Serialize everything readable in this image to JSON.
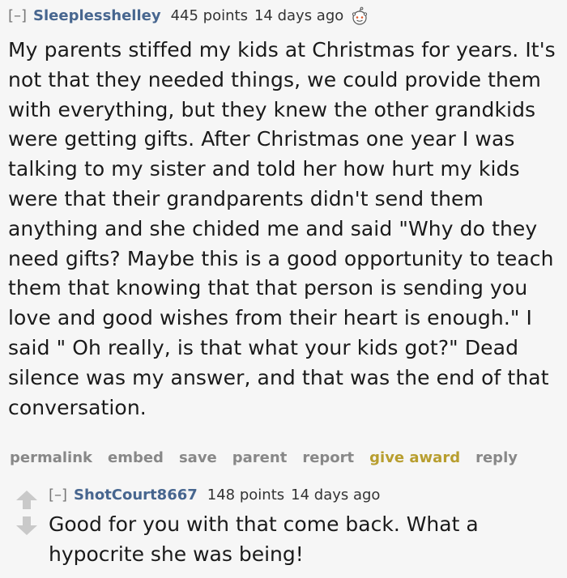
{
  "comment": {
    "collapse_label": "[–]",
    "author": "Sleeplesshelley",
    "points": "445 points",
    "age": "14 days ago",
    "award_icon": "award-face-icon",
    "body": "My parents stiffed my kids at Christmas for years. It's not that they needed things, we could provide them with everything, but they knew the other grandkids were getting gifts. After Christmas one year I was talking to my sister and told her how hurt my kids were that their grandparents didn't send them anything and she chided me and said \"Why do they need gifts? Maybe this is a good opportunity to teach them that knowing that that person is sending you love and good wishes from their heart is enough.\" I said \" Oh really, is that what your kids got?\" Dead silence was my answer, and that was the end of that conversation.",
    "buttons": {
      "permalink": "permalink",
      "embed": "embed",
      "save": "save",
      "parent": "parent",
      "report": "report",
      "give_award": "give award",
      "reply": "reply"
    }
  },
  "reply": {
    "collapse_label": "[–]",
    "author": "ShotCourt8667",
    "points": "148 points",
    "age": "14 days ago",
    "body": "Good for you with that come back. What a hypocrite she was being!"
  },
  "colors": {
    "author": "#47668f",
    "buttons": "#888888",
    "give_award": "#b89e2f",
    "vote_arrow": "#c9c9c9",
    "background": "#f6f6f6"
  }
}
